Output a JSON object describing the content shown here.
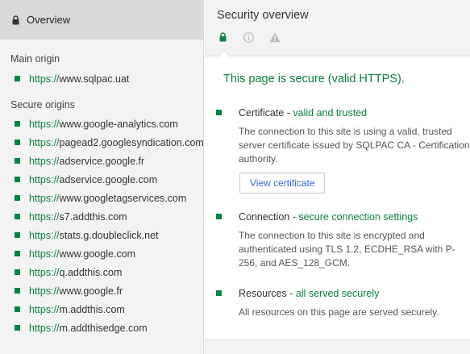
{
  "sidebar": {
    "overview_label": "Overview",
    "main_origin_title": "Main origin",
    "main_origin": {
      "scheme": "https://",
      "host": "www.sqlpac.uat"
    },
    "secure_origins_title": "Secure origins",
    "secure_origins": [
      {
        "scheme": "https://",
        "host": "www.google-analytics.com"
      },
      {
        "scheme": "https://",
        "host": "pagead2.googlesyndication.com"
      },
      {
        "scheme": "https://",
        "host": "adservice.google.fr"
      },
      {
        "scheme": "https://",
        "host": "adservice.google.com"
      },
      {
        "scheme": "https://",
        "host": "www.googletagservices.com"
      },
      {
        "scheme": "https://",
        "host": "s7.addthis.com"
      },
      {
        "scheme": "https://",
        "host": "stats.g.doubleclick.net"
      },
      {
        "scheme": "https://",
        "host": "www.google.com"
      },
      {
        "scheme": "https://",
        "host": "q.addthis.com"
      },
      {
        "scheme": "https://",
        "host": "www.google.fr"
      },
      {
        "scheme": "https://",
        "host": "m.addthis.com"
      },
      {
        "scheme": "https://",
        "host": "m.addthisedge.com"
      }
    ]
  },
  "main": {
    "title": "Security overview",
    "tabs": [
      "lock-icon",
      "info-icon",
      "warning-icon"
    ],
    "summary": "This page is secure (valid HTTPS).",
    "certificate": {
      "title": "Certificate",
      "summary": "valid and trusted",
      "description": "The connection to this site is using a valid, trusted server certificate issued by SQLPAC CA - Certification authority.",
      "button": "View certificate"
    },
    "connection": {
      "title": "Connection",
      "summary": "secure connection settings",
      "description": "The connection to this site is encrypted and authenticated using TLS 1.2, ECDHE_RSA with P-256, and AES_128_GCM."
    },
    "resources": {
      "title": "Resources",
      "summary": "all served securely",
      "description": "All resources on this page are served securely."
    }
  },
  "colors": {
    "secure_green": "#0b8043",
    "link_blue": "#3367d6",
    "panel_gray": "#f3f3f3",
    "selected_gray": "#dadada"
  }
}
